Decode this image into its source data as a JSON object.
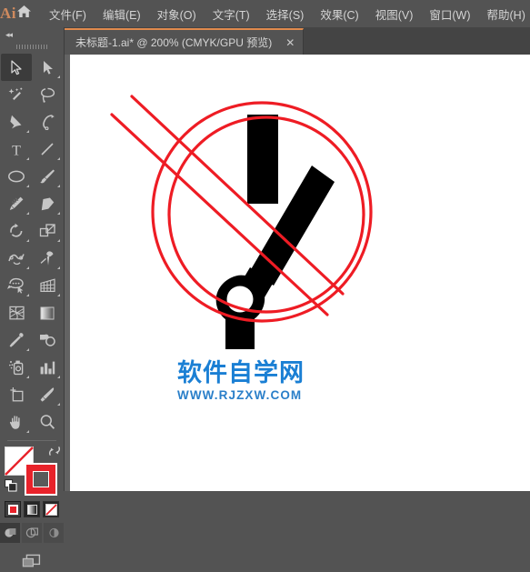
{
  "app": {
    "name": "Ai",
    "logo_color": "#cf8a5e",
    "home_icon": "home-icon"
  },
  "menubar": {
    "items": [
      {
        "label": "文件(F)",
        "name": "menu-file"
      },
      {
        "label": "编辑(E)",
        "name": "menu-edit"
      },
      {
        "label": "对象(O)",
        "name": "menu-object"
      },
      {
        "label": "文字(T)",
        "name": "menu-type"
      },
      {
        "label": "选择(S)",
        "name": "menu-select"
      },
      {
        "label": "效果(C)",
        "name": "menu-effect"
      },
      {
        "label": "视图(V)",
        "name": "menu-view"
      },
      {
        "label": "窗口(W)",
        "name": "menu-window"
      },
      {
        "label": "帮助(H)",
        "name": "menu-help"
      }
    ]
  },
  "tabbar": {
    "tab_title": "未标题-1.ai* @ 200% (CMYK/GPU 预览)",
    "close_label": "✕"
  },
  "toolbar": {
    "collapse_label": "◂◂",
    "tools": [
      {
        "name": "selection-tool",
        "label": "选择工具",
        "icon": "arrow-cursor-icon",
        "active": true,
        "corner": false
      },
      {
        "name": "direct-selection-tool",
        "label": "直接选择工具",
        "icon": "direct-arrow-icon",
        "active": false,
        "corner": true
      },
      {
        "name": "magic-wand-tool",
        "label": "魔棒工具",
        "icon": "magic-wand-icon",
        "active": false,
        "corner": false
      },
      {
        "name": "lasso-tool",
        "label": "套索工具",
        "icon": "lasso-icon",
        "active": false,
        "corner": false
      },
      {
        "name": "pen-tool",
        "label": "钢笔工具",
        "icon": "pen-nib-icon",
        "active": false,
        "corner": true
      },
      {
        "name": "curvature-tool",
        "label": "曲率工具",
        "icon": "curvature-icon",
        "active": false,
        "corner": false
      },
      {
        "name": "type-tool",
        "label": "文字工具",
        "icon": "type-t-icon",
        "active": false,
        "corner": true
      },
      {
        "name": "line-segment-tool",
        "label": "直线段工具",
        "icon": "line-segment-icon",
        "active": false,
        "corner": true
      },
      {
        "name": "ellipse-tool",
        "label": "椭圆工具",
        "icon": "ellipse-icon",
        "active": false,
        "corner": true
      },
      {
        "name": "paintbrush-tool",
        "label": "画笔工具",
        "icon": "paintbrush-icon",
        "active": false,
        "corner": true
      },
      {
        "name": "shaper-pencil-tool",
        "label": "Shaper 工具",
        "icon": "pencil-icon",
        "active": false,
        "corner": true
      },
      {
        "name": "eraser-tool",
        "label": "橡皮擦工具",
        "icon": "eraser-icon",
        "active": false,
        "corner": true
      },
      {
        "name": "rotate-tool",
        "label": "旋转工具",
        "icon": "rotate-icon",
        "active": false,
        "corner": true
      },
      {
        "name": "scale-tool",
        "label": "比例缩放工具",
        "icon": "scale-icon",
        "active": false,
        "corner": true
      },
      {
        "name": "width-warp-tool",
        "label": "宽度工具",
        "icon": "warp-icon",
        "active": false,
        "corner": true
      },
      {
        "name": "free-transform-tool",
        "label": "自由变换工具",
        "icon": "pushpin-icon",
        "active": false,
        "corner": true
      },
      {
        "name": "shape-builder-tool",
        "label": "形状生成器工具",
        "icon": "shape-builder-icon",
        "active": false,
        "corner": true
      },
      {
        "name": "perspective-grid-tool",
        "label": "透视网格工具",
        "icon": "perspective-grid-icon",
        "active": false,
        "corner": true
      },
      {
        "name": "mesh-tool",
        "label": "网格工具",
        "icon": "mesh-icon",
        "active": false,
        "corner": false
      },
      {
        "name": "gradient-tool",
        "label": "渐变工具",
        "icon": "gradient-icon",
        "active": false,
        "corner": false
      },
      {
        "name": "eyedropper-tool",
        "label": "吸管工具",
        "icon": "eyedropper-icon",
        "active": false,
        "corner": true
      },
      {
        "name": "blend-tool",
        "label": "混合工具",
        "icon": "blend-icon",
        "active": false,
        "corner": false
      },
      {
        "name": "symbol-sprayer-tool",
        "label": "符号喷枪工具",
        "icon": "symbol-sprayer-icon",
        "active": false,
        "corner": true
      },
      {
        "name": "column-graph-tool",
        "label": "柱形图工具",
        "icon": "bar-chart-icon",
        "active": false,
        "corner": true
      },
      {
        "name": "artboard-tool",
        "label": "画板工具",
        "icon": "artboard-icon",
        "active": false,
        "corner": false
      },
      {
        "name": "slice-tool",
        "label": "切片工具",
        "icon": "slice-knife-icon",
        "active": false,
        "corner": true
      },
      {
        "name": "hand-tool",
        "label": "抓手工具",
        "icon": "hand-icon",
        "active": false,
        "corner": true
      },
      {
        "name": "zoom-tool",
        "label": "缩放工具",
        "icon": "magnifier-icon",
        "active": false,
        "corner": false
      }
    ],
    "fill_stroke": {
      "fill_label": "填色",
      "fill_value": "无",
      "fill_color": "#ffffff",
      "stroke_label": "描边",
      "stroke_color": "#e8222a",
      "swap_label": "互换填色和描边",
      "default_label": "默认填色和描边"
    },
    "paint_modes": [
      {
        "name": "color-mode-button",
        "label": "颜色",
        "selected": true
      },
      {
        "name": "gradient-mode-button",
        "label": "渐变",
        "selected": false
      },
      {
        "name": "none-mode-button",
        "label": "无",
        "selected": false
      }
    ],
    "draw_modes": [
      {
        "name": "draw-normal-button",
        "label": "正常绘图",
        "selected": true
      },
      {
        "name": "draw-behind-button",
        "label": "背面绘图",
        "selected": false
      },
      {
        "name": "draw-inside-button",
        "label": "内部绘图",
        "selected": false
      }
    ],
    "screen_mode": {
      "name": "screen-mode-button",
      "label": "更改屏幕模式"
    }
  },
  "canvas": {
    "zoom_level": "200%",
    "artwork_name": "no-wiper-prohibition-sign",
    "colors": {
      "red": "#ee1c24",
      "black": "#000000",
      "artboard": "#ffffff"
    }
  },
  "watermark": {
    "cn": "软件自学网",
    "url": "WWW.RJZXW.COM",
    "color": "#1a7fd4"
  }
}
